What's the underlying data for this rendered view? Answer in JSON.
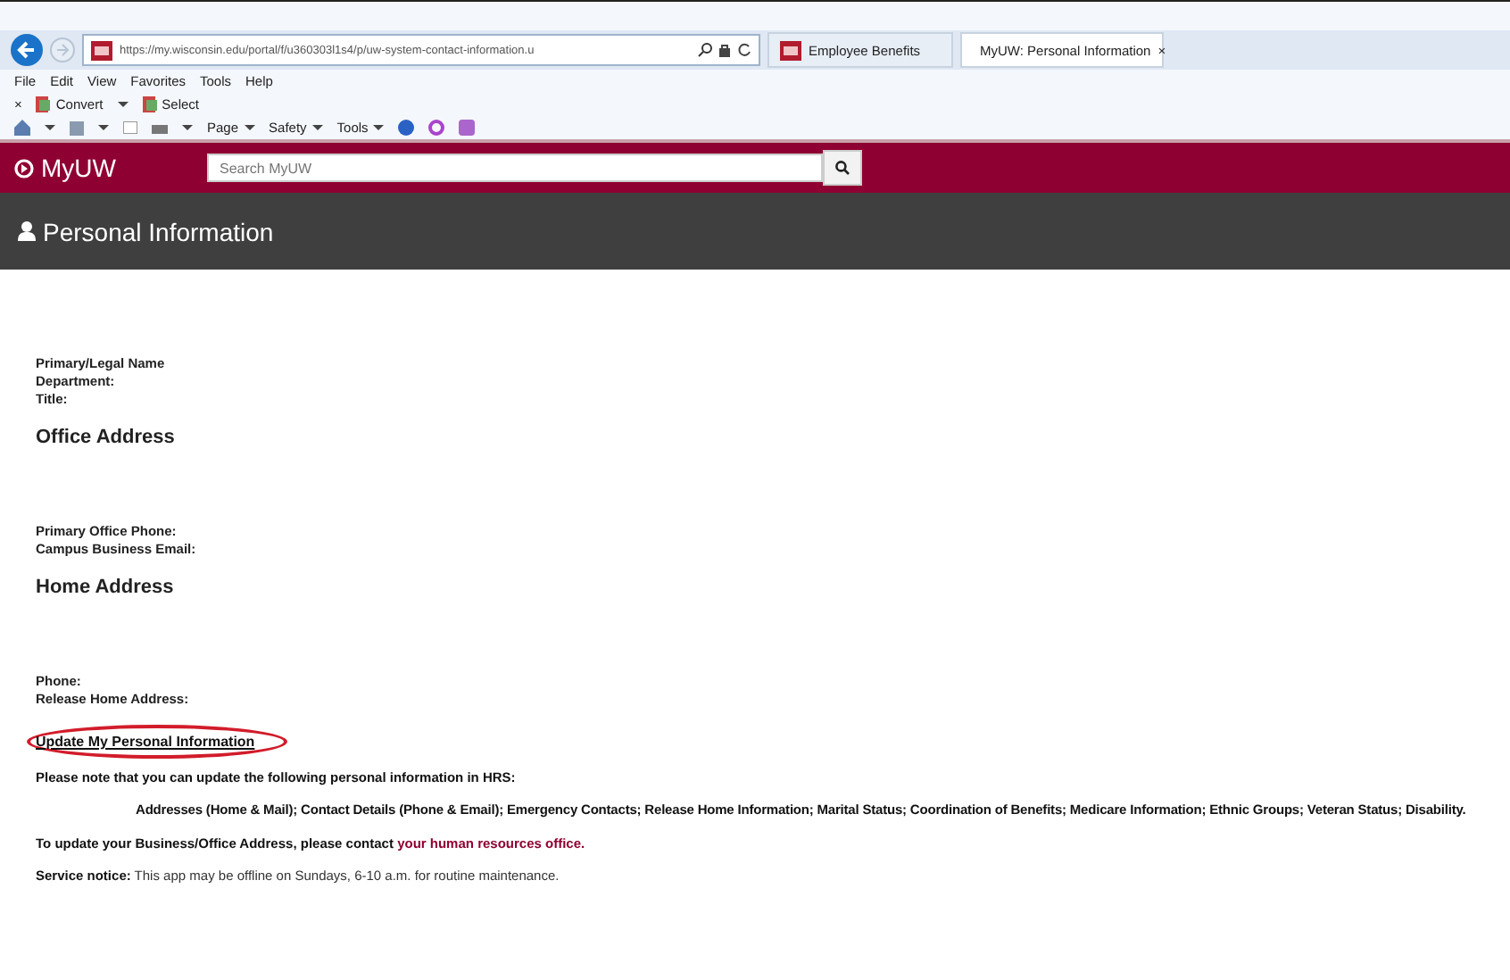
{
  "browser": {
    "url": "https://my.wisconsin.edu/portal/f/u360303l1s4/p/uw-system-contact-information.u",
    "tabs": [
      {
        "label": "Employee Benefits",
        "selected": false,
        "closable": false
      },
      {
        "label": "MyUW: Personal Information",
        "selected": true,
        "closable": true
      }
    ],
    "close_glyph": "×",
    "menu": [
      "File",
      "Edit",
      "View",
      "Favorites",
      "Tools",
      "Help"
    ],
    "convert_bar": [
      {
        "kind": "glyph",
        "label": "×"
      },
      {
        "kind": "button",
        "label": "Convert",
        "caret": true
      },
      {
        "kind": "button",
        "label": "Select",
        "caret": false
      }
    ],
    "command_bar": [
      "Page",
      "Safety",
      "Tools"
    ]
  },
  "header": {
    "logo": "MyUW",
    "search": {
      "placeholder": "Search MyUW"
    }
  },
  "page_title": "Personal Information",
  "content": [
    {
      "kind": "field",
      "label": "Primary/Legal Name"
    },
    {
      "kind": "field",
      "label": "Department:"
    },
    {
      "kind": "field",
      "label": "Title:"
    },
    {
      "kind": "heading",
      "label": "Office Address"
    },
    {
      "kind": "gap"
    },
    {
      "kind": "field",
      "label": "Primary Office Phone:"
    },
    {
      "kind": "field",
      "label": "Campus Business Email:"
    },
    {
      "kind": "heading",
      "label": "Home Address"
    },
    {
      "kind": "gap"
    },
    {
      "kind": "field",
      "label": "Phone:"
    },
    {
      "kind": "field",
      "label": "Release Home Address:"
    },
    {
      "kind": "link",
      "label": "Update My Personal Information",
      "circled": true
    },
    {
      "kind": "para",
      "label": "Please note that you can update the following personal information in HRS:"
    },
    {
      "kind": "indent",
      "label": "Addresses (Home & Mail); Contact Details (Phone & Email); Emergency Contacts; Release Home Information; Marital Status; Coordination of Benefits; Medicare Information; Ethnic Groups; Veteran Status; Disability."
    },
    {
      "kind": "para",
      "label": "To update your Business/Office Address, please contact",
      "link": "your human resources office."
    },
    {
      "kind": "notice",
      "label": "**Service notice:** This app may be offline on Sundays, 6-10 a.m. for routine maintenance."
    }
  ]
}
